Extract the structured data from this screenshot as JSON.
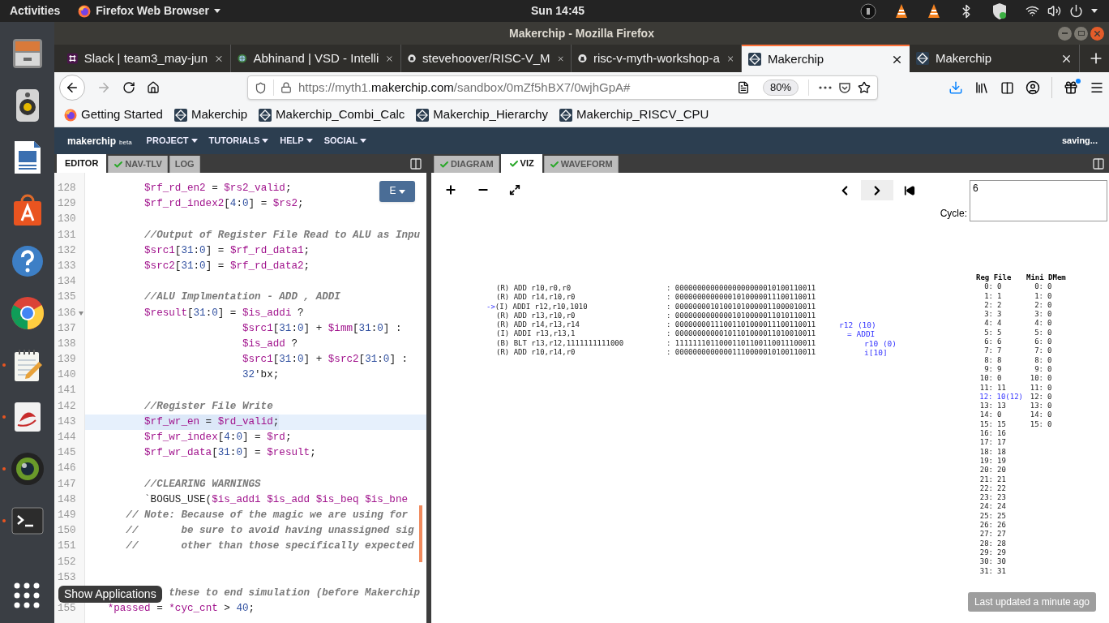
{
  "top_bar": {
    "activities": "Activities",
    "app_menu": "Firefox Web Browser",
    "clock": "Sun 14:45"
  },
  "dock": {
    "items": [
      {
        "kind": "files",
        "running": false
      },
      {
        "kind": "music",
        "running": false
      },
      {
        "kind": "writer",
        "running": false
      },
      {
        "kind": "software",
        "running": false
      },
      {
        "kind": "help",
        "running": false
      },
      {
        "kind": "chrome",
        "running": false
      },
      {
        "kind": "editor",
        "running": true
      },
      {
        "kind": "reader",
        "running": true
      },
      {
        "kind": "camera",
        "running": true
      },
      {
        "kind": "terminal",
        "running": true
      }
    ],
    "show_apps_tooltip": "Show Applications"
  },
  "window": {
    "title": "Makerchip - Mozilla Firefox"
  },
  "tabs": [
    {
      "title": "Slack | team3_may-jun",
      "kind": "slack",
      "selected": false
    },
    {
      "title": "Abhinand | VSD - Intelli",
      "kind": "globe",
      "selected": false
    },
    {
      "title": "stevehoover/RISC-V_M",
      "kind": "github",
      "selected": false
    },
    {
      "title": "risc-v-myth-workshop-a",
      "kind": "github",
      "selected": false
    },
    {
      "title": "Makerchip",
      "kind": "makerchip",
      "selected": true
    },
    {
      "title": "Makerchip",
      "kind": "makerchip",
      "selected": false
    }
  ],
  "address_bar": {
    "prefix": "https://myth1.",
    "domain": "makerchip.com",
    "path": "/sandbox/0mZf5hBX7/0wjhGpA#",
    "zoom": "80%"
  },
  "bookmarks": [
    {
      "title": "Getting Started",
      "kind": "firefox"
    },
    {
      "title": "Makerchip",
      "kind": "makerchip"
    },
    {
      "title": "Makerchip_Combi_Calc",
      "kind": "makerchip"
    },
    {
      "title": "Makerchip_Hierarchy",
      "kind": "makerchip"
    },
    {
      "title": "Makerchip_RISCV_CPU",
      "kind": "makerchip"
    }
  ],
  "app_nav": {
    "logo": "makerchip",
    "logo_tag": "beta",
    "menus": [
      "PROJECT",
      "TUTORIALS",
      "HELP",
      "SOCIAL"
    ],
    "status": "saving..."
  },
  "editor_pane": {
    "tabs": [
      {
        "label": "EDITOR",
        "checked": false,
        "selected": true
      },
      {
        "label": "NAV-TLV",
        "checked": true,
        "selected": false
      },
      {
        "label": "LOG",
        "checked": false,
        "selected": false
      }
    ],
    "mode_button": "E",
    "lines": [
      {
        "number": "128",
        "code": "         $rf_rd_en2 = $rs2_valid;",
        "kind": "code",
        "highlighted": false
      },
      {
        "number": "129",
        "code": "         $rf_rd_index2[4:0] = $rs2;",
        "kind": "code",
        "highlighted": false
      },
      {
        "number": "130",
        "kind": "blank",
        "highlighted": false
      },
      {
        "number": "131",
        "code": "         //Output of Register File Read to ALU as Inpu",
        "kind": "comment",
        "highlighted": false
      },
      {
        "number": "132",
        "code": "         $src1[31:0] = $rf_rd_data1;",
        "kind": "code",
        "highlighted": false
      },
      {
        "number": "133",
        "code": "         $src2[31:0] = $rf_rd_data2;",
        "kind": "code",
        "highlighted": false
      },
      {
        "number": "134",
        "kind": "blank",
        "highlighted": false
      },
      {
        "number": "135",
        "code": "         //ALU Implmentation - ADD , ADDI",
        "kind": "comment",
        "highlighted": false
      },
      {
        "number": "136",
        "code": "         $result[31:0] = $is_addi ?",
        "kind": "fold",
        "highlighted": false
      },
      {
        "number": "137",
        "code": "                         $src1[31:0] + $imm[31:0] :",
        "kind": "code",
        "highlighted": false
      },
      {
        "number": "138",
        "code": "                         $is_add ?",
        "kind": "code",
        "highlighted": false
      },
      {
        "number": "139",
        "code": "                         $src1[31:0] + $src2[31:0] :",
        "kind": "code",
        "highlighted": false
      },
      {
        "number": "140",
        "code": "                         32'bx;",
        "kind": "code",
        "highlighted": false
      },
      {
        "number": "141",
        "kind": "blank",
        "highlighted": false
      },
      {
        "number": "142",
        "code": "         //Register File Write",
        "kind": "comment",
        "highlighted": false
      },
      {
        "number": "143",
        "code": "         $rf_wr_en = $rd_valid;",
        "kind": "code",
        "highlighted": true
      },
      {
        "number": "144",
        "code": "         $rf_wr_index[4:0] = $rd;",
        "kind": "code",
        "highlighted": false
      },
      {
        "number": "145",
        "code": "         $rf_wr_data[31:0] = $result;",
        "kind": "code",
        "highlighted": false
      },
      {
        "number": "146",
        "kind": "blank",
        "highlighted": false
      },
      {
        "number": "147",
        "code": "         //CLEARING WARNINGS",
        "kind": "comment",
        "highlighted": false
      },
      {
        "number": "148",
        "code": "         `BOGUS_USE($is_addi $is_add $is_beq $is_bne",
        "kind": "code",
        "highlighted": false
      },
      {
        "number": "149",
        "code": "      // Note: Because of the magic we are using for",
        "kind": "comment",
        "highlighted": false
      },
      {
        "number": "150",
        "code": "      //       be sure to avoid having unassigned sig",
        "kind": "comment",
        "highlighted": false
      },
      {
        "number": "151",
        "code": "      //       other than those specifically expected",
        "kind": "comment",
        "highlighted": false
      },
      {
        "number": "152",
        "kind": "blank",
        "highlighted": false
      },
      {
        "number": "153",
        "kind": "blank",
        "highlighted": false
      },
      {
        "code": "             these to end simulation (before Makerchip",
        "kind": "comment",
        "highlighted": false
      },
      {
        "number": "155",
        "code": "   *passed = *cyc_cnt > 40;",
        "kind": "code",
        "highlighted": false
      }
    ]
  },
  "viz_pane": {
    "tabs": [
      {
        "label": "DIAGRAM",
        "checked": true,
        "selected": false
      },
      {
        "label": "VIZ",
        "checked": true,
        "selected": true
      },
      {
        "label": "WAVEFORM",
        "checked": true,
        "selected": false
      }
    ],
    "cycle_label": "Cycle:",
    "cycle_value": "6",
    "pointer": "->",
    "instructions": [
      {
        "asm": "(R) ADD r10,r0,r0",
        "bin": ": 00000000000000000000010100110011",
        "current": false
      },
      {
        "asm": "(R) ADD r14,r10,r0",
        "bin": ": 00000000000001010000011100110011",
        "current": false
      },
      {
        "asm": "(I) ADDI r12,r10,1010",
        "bin": ": 00000000101001010000011000010011",
        "current": true
      },
      {
        "asm": "(R) ADD r13,r10,r0",
        "bin": ": 00000000000001010000011010110011",
        "current": false
      },
      {
        "asm": "(R) ADD r14,r13,r14",
        "bin": ": 00000000111001101000011100110011",
        "current": false
      },
      {
        "asm": "(I) ADDI r13,r13,1",
        "bin": ": 00000000000101101000011010010011",
        "current": false
      },
      {
        "asm": "(B) BLT r13,r12,1111111111000",
        "bin": ": 11111110110001101100110011100011",
        "current": false
      },
      {
        "asm": "(R) ADD r10,r14,r0",
        "bin": ": 00000000000001110000010100110011",
        "current": false
      }
    ],
    "annotations": [
      "r12 (10)",
      "= ADDI",
      "r10 (0)",
      "i[10]"
    ],
    "reg_file": {
      "title": "Reg File",
      "rows": [
        {
          "reg": "0:",
          "value": "0",
          "changed": false
        },
        {
          "reg": "1:",
          "value": "1",
          "changed": false
        },
        {
          "reg": "2:",
          "value": "2",
          "changed": false
        },
        {
          "reg": "3:",
          "value": "3",
          "changed": false
        },
        {
          "reg": "4:",
          "value": "4",
          "changed": false
        },
        {
          "reg": "5:",
          "value": "5",
          "changed": false
        },
        {
          "reg": "6:",
          "value": "6",
          "changed": false
        },
        {
          "reg": "7:",
          "value": "7",
          "changed": false
        },
        {
          "reg": "8:",
          "value": "8",
          "changed": false
        },
        {
          "reg": "9:",
          "value": "9",
          "changed": false
        },
        {
          "reg": "10:",
          "value": "0",
          "changed": false
        },
        {
          "reg": "11:",
          "value": "11",
          "changed": false
        },
        {
          "reg": "12:",
          "value": "10(12)",
          "changed": true
        },
        {
          "reg": "13:",
          "value": "13",
          "changed": false
        },
        {
          "reg": "14:",
          "value": "0",
          "changed": false
        },
        {
          "reg": "15:",
          "value": "15",
          "changed": false
        },
        {
          "reg": "16:",
          "value": "16",
          "changed": false
        },
        {
          "reg": "17:",
          "value": "17",
          "changed": false
        },
        {
          "reg": "18:",
          "value": "18",
          "changed": false
        },
        {
          "reg": "19:",
          "value": "19",
          "changed": false
        },
        {
          "reg": "20:",
          "value": "20",
          "changed": false
        },
        {
          "reg": "21:",
          "value": "21",
          "changed": false
        },
        {
          "reg": "22:",
          "value": "22",
          "changed": false
        },
        {
          "reg": "23:",
          "value": "23",
          "changed": false
        },
        {
          "reg": "24:",
          "value": "24",
          "changed": false
        },
        {
          "reg": "25:",
          "value": "25",
          "changed": false
        },
        {
          "reg": "26:",
          "value": "26",
          "changed": false
        },
        {
          "reg": "27:",
          "value": "27",
          "changed": false
        },
        {
          "reg": "28:",
          "value": "28",
          "changed": false
        },
        {
          "reg": "29:",
          "value": "29",
          "changed": false
        },
        {
          "reg": "30:",
          "value": "30",
          "changed": false
        },
        {
          "reg": "31:",
          "value": "31",
          "changed": false
        }
      ]
    },
    "dmem": {
      "title": "Mini DMem",
      "rows": [
        {
          "reg": "0:",
          "value": "0"
        },
        {
          "reg": "1:",
          "value": "0"
        },
        {
          "reg": "2:",
          "value": "0"
        },
        {
          "reg": "3:",
          "value": "0"
        },
        {
          "reg": "4:",
          "value": "0"
        },
        {
          "reg": "5:",
          "value": "0"
        },
        {
          "reg": "6:",
          "value": "0"
        },
        {
          "reg": "7:",
          "value": "0"
        },
        {
          "reg": "8:",
          "value": "0"
        },
        {
          "reg": "9:",
          "value": "0"
        },
        {
          "reg": "10:",
          "value": "0"
        },
        {
          "reg": "11:",
          "value": "0"
        },
        {
          "reg": "12:",
          "value": "0"
        },
        {
          "reg": "13:",
          "value": "0"
        },
        {
          "reg": "14:",
          "value": "0"
        },
        {
          "reg": "15:",
          "value": "0"
        }
      ]
    },
    "toast": "Last updated a minute ago"
  }
}
